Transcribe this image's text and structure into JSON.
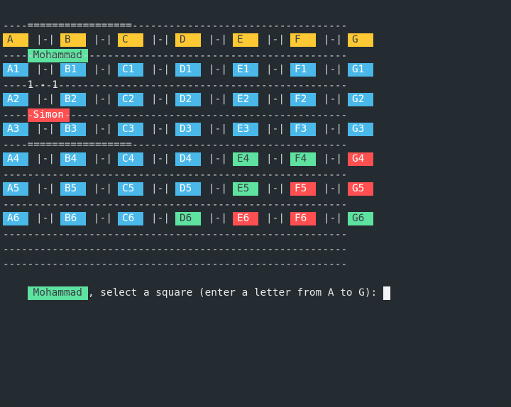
{
  "header": {
    "left_rule": "=================",
    "player1": "Mohammad",
    "score": "1 - 1",
    "player2": "Simon",
    "right_rule": "================="
  },
  "separator": "--------------------------------------------------------",
  "column_divider": "|-|",
  "colors": {
    "background": "#252c31",
    "header_cell": "#fcc833",
    "empty_cell": "#4ab8e9",
    "player1": "#5ee2a0",
    "player2": "#ff4f51",
    "dark_text": "#3a3f44",
    "light_text": "#ffffff"
  },
  "columns": [
    "A",
    "B",
    "C",
    "D",
    "E",
    "F",
    "G"
  ],
  "rows": [
    [
      {
        "t": "A1",
        "s": "empty"
      },
      {
        "t": "B1",
        "s": "empty"
      },
      {
        "t": "C1",
        "s": "empty"
      },
      {
        "t": "D1",
        "s": "empty"
      },
      {
        "t": "E1",
        "s": "empty"
      },
      {
        "t": "F1",
        "s": "empty"
      },
      {
        "t": "G1",
        "s": "empty"
      }
    ],
    [
      {
        "t": "A2",
        "s": "empty"
      },
      {
        "t": "B2",
        "s": "empty"
      },
      {
        "t": "C2",
        "s": "empty"
      },
      {
        "t": "D2",
        "s": "empty"
      },
      {
        "t": "E2",
        "s": "empty"
      },
      {
        "t": "F2",
        "s": "empty"
      },
      {
        "t": "G2",
        "s": "empty"
      }
    ],
    [
      {
        "t": "A3",
        "s": "empty"
      },
      {
        "t": "B3",
        "s": "empty"
      },
      {
        "t": "C3",
        "s": "empty"
      },
      {
        "t": "D3",
        "s": "empty"
      },
      {
        "t": "E3",
        "s": "empty"
      },
      {
        "t": "F3",
        "s": "empty"
      },
      {
        "t": "G3",
        "s": "empty"
      }
    ],
    [
      {
        "t": "A4",
        "s": "empty"
      },
      {
        "t": "B4",
        "s": "empty"
      },
      {
        "t": "C4",
        "s": "empty"
      },
      {
        "t": "D4",
        "s": "empty"
      },
      {
        "t": "E4",
        "s": "p1"
      },
      {
        "t": "F4",
        "s": "p1"
      },
      {
        "t": "G4",
        "s": "p2"
      }
    ],
    [
      {
        "t": "A5",
        "s": "empty"
      },
      {
        "t": "B5",
        "s": "empty"
      },
      {
        "t": "C5",
        "s": "empty"
      },
      {
        "t": "D5",
        "s": "empty"
      },
      {
        "t": "E5",
        "s": "p1"
      },
      {
        "t": "F5",
        "s": "p2"
      },
      {
        "t": "G5",
        "s": "p2"
      }
    ],
    [
      {
        "t": "A6",
        "s": "empty"
      },
      {
        "t": "B6",
        "s": "empty"
      },
      {
        "t": "C6",
        "s": "empty"
      },
      {
        "t": "D6",
        "s": "p1"
      },
      {
        "t": "E6",
        "s": "p2"
      },
      {
        "t": "F6",
        "s": "p2"
      },
      {
        "t": "G6",
        "s": "p1"
      }
    ]
  ],
  "prompt": {
    "player": "Mohammad",
    "text": ", select a square (enter a letter from A to G): "
  }
}
